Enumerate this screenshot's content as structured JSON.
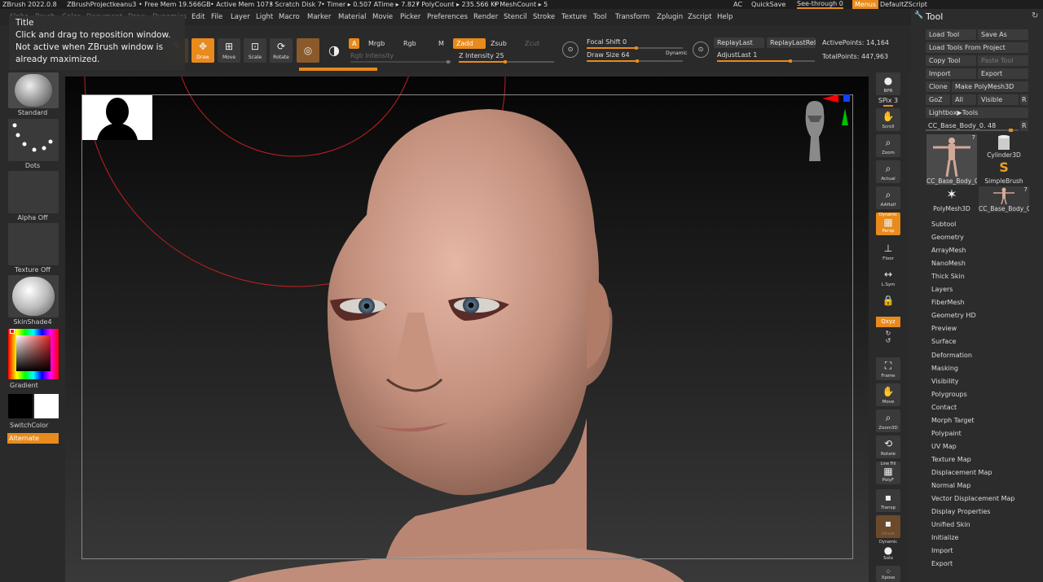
{
  "titlebar": {
    "app": "ZBrush 2022.0.8",
    "project": "ZBrushProjectkeanu3",
    "free_mem": "• Free Mem 19.566GB",
    "active_mem": "• Active Mem 1073",
    "scratch": "• Scratch Disk 7",
    "timer": "• Timer ▸ 0.507 ATime ▸ 7.827",
    "polycount": "• PolyCount ▸ 235.566 KP",
    "meshcount": "• MeshCount ▸ 5",
    "ac": "AC",
    "quicksave": "QuickSave",
    "seethrough": "See-through  0",
    "menus": "Menus",
    "zscript": "DefaultZScript"
  },
  "menubar": {
    "items": [
      "Alpha",
      "Brush",
      "Color",
      "Document",
      "Draw",
      "Dynamics",
      "Edit",
      "File",
      "Layer",
      "Light",
      "Macro",
      "Marker",
      "Material",
      "Movie",
      "Picker",
      "Preferences",
      "Render",
      "Stencil",
      "Stroke",
      "Texture",
      "Tool",
      "Transform",
      "Zplugin",
      "Zscript",
      "Help"
    ]
  },
  "tooltip": {
    "title": "Title",
    "line1": "Click and drag to reposition window.",
    "line2": "Not active when ZBrush window is already maximized."
  },
  "toolbar": {
    "draw": "Draw",
    "move": "Move",
    "scale": "Scale",
    "rotate": "Rotate",
    "a": "A",
    "mrgb": "Mrgb",
    "rgb": "Rgb",
    "m": "M",
    "zadd": "Zadd",
    "zsub": "Zsub",
    "zcut": "Zcut",
    "rgb_intensity": "Rgb Intensity",
    "z_intensity": "Z Intensity 25",
    "focal_shift": "Focal Shift 0",
    "draw_size": "Draw Size 64",
    "dynamic": "Dynamic",
    "replaylast": "ReplayLast",
    "replaylastrel": "ReplayLastRel",
    "adjustlast": "AdjustLast  1",
    "active_points": "ActivePoints: 14,164",
    "total_points": "TotalPoints: 447,963"
  },
  "leftshelf": {
    "standard": "Standard",
    "dots": "Dots",
    "alpha_off": "Alpha Off",
    "texture_off": "Texture Off",
    "material": "SkinShade4",
    "gradient": "Gradient",
    "switchcolor": "SwitchColor",
    "alternate": "Alternate"
  },
  "rightshelf": {
    "bpr": "BPR",
    "spix": "SPix 3",
    "scroll": "Scroll",
    "zoom": "Zoom",
    "actual": "Actual",
    "aahalf": "AAHalf",
    "dynamic": "Dynamic",
    "persp": "Persp",
    "floor": "Floor",
    "lsym": "L.Sym",
    "xyz": "Qxyz",
    "frame": "Frame",
    "move": "Move",
    "zoom3d": "Zoom3D",
    "rotate": "Rotate",
    "linefill": "Line Fill",
    "polyf": "PolyF",
    "transp": "Transp",
    "ghost": "Ghost",
    "dynamic2": "Dynamic",
    "solo": "Solo",
    "xpose": "Xpose"
  },
  "toolpanel": {
    "title": "Tool",
    "load_tool": "Load Tool",
    "save_as": "Save As",
    "load_from_project": "Load Tools From Project",
    "copy_tool": "Copy Tool",
    "paste_tool": "Paste Tool",
    "import": "Import",
    "export": "Export",
    "clone": "Clone",
    "make_polymesh": "Make PolyMesh3D",
    "goz": "GoZ",
    "all": "All",
    "visible": "Visible",
    "r": "R",
    "lightbox": "Lightbox▶Tools",
    "current_tool": "CC_Base_Body_0. 48",
    "r2": "R",
    "thumbs": [
      {
        "label": "CC_Base_Body_C",
        "count": "7"
      },
      {
        "label": "Cylinder3D",
        "count": ""
      },
      {
        "label": "SimpleBrush",
        "count": ""
      },
      {
        "label": "PolyMesh3D",
        "count": ""
      },
      {
        "label": "CC_Base_Body_C",
        "count": "7"
      }
    ],
    "sections": [
      "Subtool",
      "Geometry",
      "ArrayMesh",
      "NanoMesh",
      "Thick Skin",
      "Layers",
      "FiberMesh",
      "Geometry HD",
      "Preview",
      "Surface",
      "Deformation",
      "Masking",
      "Visibility",
      "Polygroups",
      "Contact",
      "Morph Target",
      "Polypaint",
      "UV Map",
      "Texture Map",
      "Displacement Map",
      "Normal Map",
      "Vector Displacement Map",
      "Display Properties",
      "Unified Skin",
      "Initialize",
      "Import",
      "Export"
    ]
  },
  "colors": {
    "accent": "#e88a1c",
    "panel": "#2a2a2a",
    "button": "#3a3a3a",
    "gizmo_red": "#ff0000",
    "gizmo_green": "#00c000",
    "gizmo_blue": "#1040ff"
  }
}
